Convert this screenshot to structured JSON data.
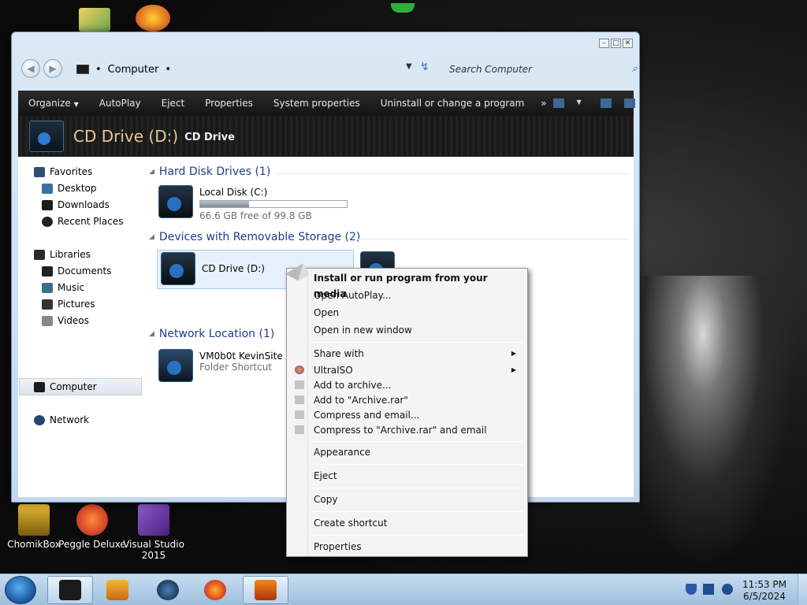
{
  "desktop": {
    "icons": [
      {
        "label": "ChomikBox"
      },
      {
        "label": "Peggle Deluxe"
      },
      {
        "label": "Visual Studio 2015"
      }
    ]
  },
  "window": {
    "address": "Computer",
    "search_placeholder": "Search Computer",
    "toolbar": {
      "organize": "Organize",
      "autoplay": "AutoPlay",
      "eject": "Eject",
      "properties": "Properties",
      "system_properties": "System properties",
      "uninstall": "Uninstall or change a program",
      "more": "»"
    },
    "header": {
      "title": "CD Drive (D:)",
      "subtitle": "CD Drive"
    },
    "nav": {
      "favorites": "Favorites",
      "desktop": "Desktop",
      "downloads": "Downloads",
      "recent_places": "Recent Places",
      "libraries": "Libraries",
      "documents": "Documents",
      "music": "Music",
      "pictures": "Pictures",
      "videos": "Videos",
      "computer": "Computer",
      "network": "Network"
    },
    "groups": {
      "hard_disk": "Hard Disk Drives (1)",
      "removable": "Devices with Removable Storage (2)",
      "network": "Network Location (1)"
    },
    "local_disk": {
      "name": "Local Disk (C:)",
      "free": "66.6 GB free of 99.8 GB",
      "used_fraction": 0.333
    },
    "cd_drive": {
      "name": "CD Drive (D:)"
    },
    "network_item": {
      "name": "VM0b0t KevinSite",
      "type": "Folder Shortcut"
    }
  },
  "context_menu": {
    "install": "Install or run program from your media",
    "open_autoplay": "Open AutoPlay...",
    "open": "Open",
    "open_new_window": "Open in new window",
    "share_with": "Share with",
    "ultraiso": "UltraISO",
    "add_archive": "Add to archive...",
    "add_archive_rar": "Add to \"Archive.rar\"",
    "compress_email": "Compress and email...",
    "compress_rar_email": "Compress to \"Archive.rar\" and email",
    "appearance": "Appearance",
    "eject": "Eject",
    "copy": "Copy",
    "create_shortcut": "Create shortcut",
    "properties": "Properties"
  },
  "taskbar": {
    "time": "11:53 PM",
    "date": "6/5/2024"
  },
  "colors": {
    "group_header": "#1e3c8c",
    "header_title": "#e8c890",
    "taskbar": "#b3cfe8"
  }
}
